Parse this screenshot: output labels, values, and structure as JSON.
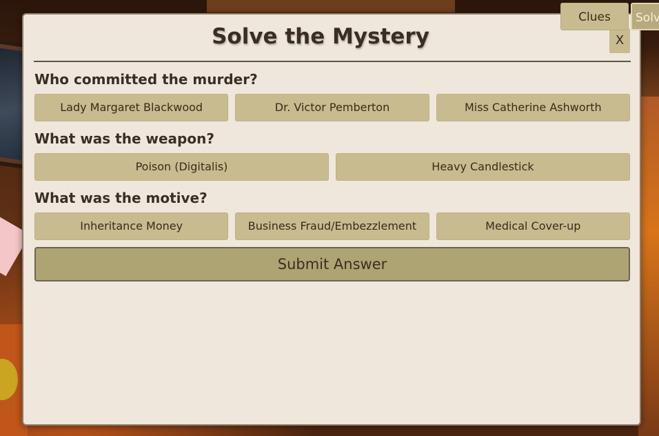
{
  "tabs": {
    "clues_label": "Clues",
    "solve_label": "Solve"
  },
  "modal": {
    "title": "Solve the Mystery",
    "close_label": "X",
    "questions": {
      "murderer": {
        "prompt": "Who committed the murder?",
        "options": [
          "Lady Margaret Blackwood",
          "Dr. Victor Pemberton",
          "Miss Catherine Ashworth"
        ]
      },
      "weapon": {
        "prompt": "What was the weapon?",
        "options": [
          "Poison (Digitalis)",
          "Heavy Candlestick"
        ]
      },
      "motive": {
        "prompt": "What was the motive?",
        "options": [
          "Inheritance Money",
          "Business Fraud/Embezzlement",
          "Medical Cover-up"
        ]
      }
    },
    "submit_label": "Submit Answer"
  },
  "colors": {
    "modal_background": "#efe7dc",
    "button_background": "#c8bb8f",
    "submit_background": "#aea372",
    "text": "#3a2e24"
  }
}
